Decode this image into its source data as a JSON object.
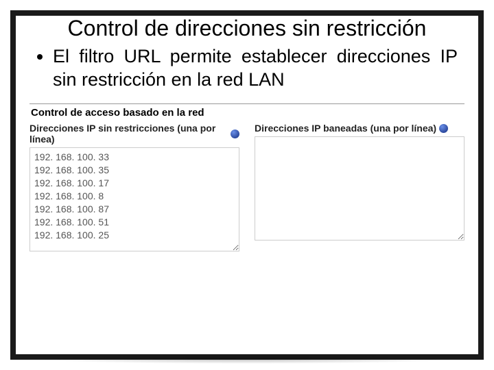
{
  "title": "Control de direcciones sin restricción",
  "bullet": "El filtro URL permite establecer direcciones IP sin restricción en la red LAN",
  "panel": {
    "heading": "Control de acceso basado en la red",
    "left": {
      "label": "Direcciones IP sin restricciones (una por línea)",
      "value": "192. 168. 100. 33\n192. 168. 100. 35\n192. 168. 100. 17\n192. 168. 100. 8\n192. 168. 100. 87\n192. 168. 100. 51\n192. 168. 100. 25"
    },
    "right": {
      "label": "Direcciones IP baneadas (una por línea)",
      "value": ""
    }
  }
}
